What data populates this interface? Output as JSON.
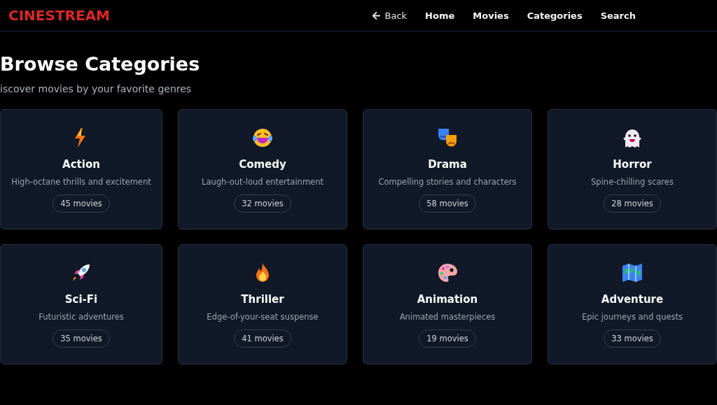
{
  "header": {
    "logo": "CINESTREAM",
    "back": "Back",
    "nav": [
      "Home",
      "Movies",
      "Categories",
      "Search"
    ]
  },
  "page": {
    "title": "Browse Categories",
    "subtitle": "iscover movies by your favorite genres"
  },
  "categories": [
    {
      "name": "Action",
      "description": "High-octane thrills and excitement",
      "count": "45 movies"
    },
    {
      "name": "Comedy",
      "description": "Laugh-out-loud entertainment",
      "count": "32 movies"
    },
    {
      "name": "Drama",
      "description": "Compelling stories and characters",
      "count": "58 movies"
    },
    {
      "name": "Horror",
      "description": "Spine-chilling scares",
      "count": "28 movies"
    },
    {
      "name": "Sci-Fi",
      "description": "Futuristic adventures",
      "count": "35 movies"
    },
    {
      "name": "Thriller",
      "description": "Edge-of-your-seat suspense",
      "count": "41 movies"
    },
    {
      "name": "Animation",
      "description": "Animated masterpieces",
      "count": "19 movies"
    },
    {
      "name": "Adventure",
      "description": "Epic journeys and quests",
      "count": "33 movies"
    }
  ]
}
